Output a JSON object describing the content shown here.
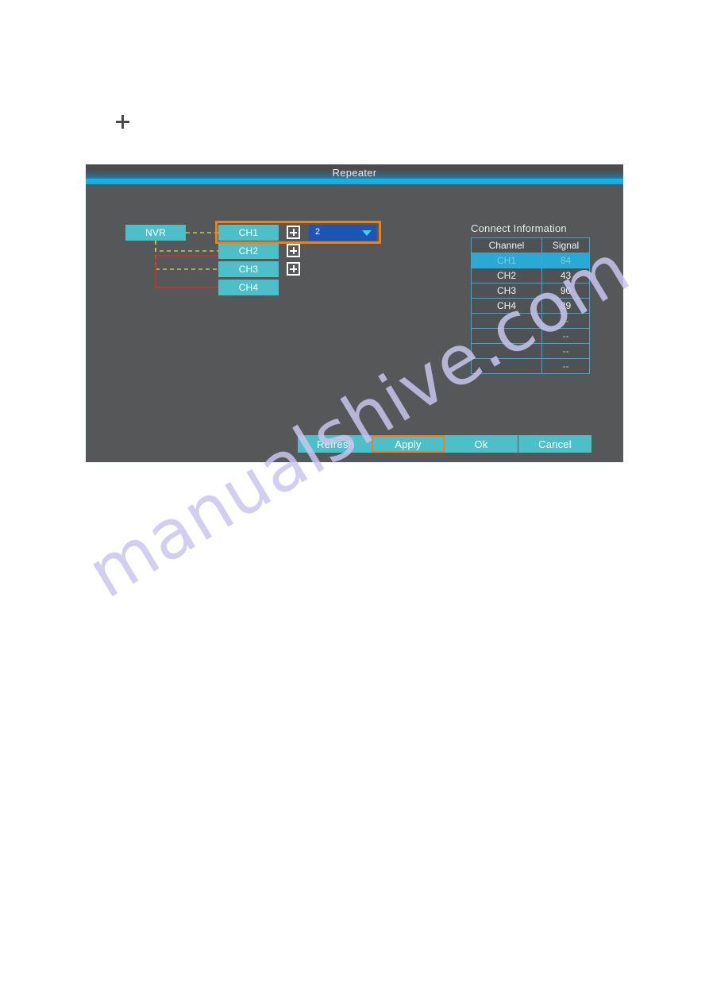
{
  "page": {
    "plus_mark": "plus",
    "watermark": "manualshive.com"
  },
  "dialog": {
    "title": "Repeater",
    "diagram": {
      "root_label": "NVR",
      "channels": [
        {
          "label": "CH1",
          "has_expander": true,
          "link_style": "dashed-yellow"
        },
        {
          "label": "CH2",
          "has_expander": true,
          "link_style": "dashed-yellow"
        },
        {
          "label": "CH3",
          "has_expander": true,
          "link_style": "dashed-yellow"
        },
        {
          "label": "CH4",
          "has_expander": false,
          "link_style": "solid-red"
        }
      ],
      "dropdown": {
        "value": "2",
        "arrow_icon": "chevron-down-icon"
      },
      "expander_icon": "plus-box-icon",
      "highlight_color": "#f0801b"
    },
    "connect_information": {
      "title": "Connect Information",
      "columns": [
        "Channel",
        "Signal"
      ],
      "rows": [
        {
          "channel": "CH1",
          "signal": "84",
          "selected": true
        },
        {
          "channel": "CH2",
          "signal": "43",
          "selected": false
        },
        {
          "channel": "CH3",
          "signal": "90",
          "selected": false
        },
        {
          "channel": "CH4",
          "signal": "89",
          "selected": false
        },
        {
          "channel": "",
          "signal": "--",
          "selected": false
        },
        {
          "channel": "",
          "signal": "--",
          "selected": false
        },
        {
          "channel": "",
          "signal": "--",
          "selected": false
        },
        {
          "channel": "",
          "signal": "--",
          "selected": false
        }
      ]
    },
    "buttons": {
      "refresh": "Refresh",
      "apply": "Apply",
      "ok": "Ok",
      "cancel": "Cancel",
      "focused": "apply"
    },
    "colors": {
      "accent_teal": "#4cbfc9",
      "highlight_orange": "#f0801b",
      "dropdown_blue": "#1c56b4",
      "selected_row": "#2aa9d4",
      "title_bar": "#0fb3e8",
      "body_gray": "#555759"
    }
  }
}
